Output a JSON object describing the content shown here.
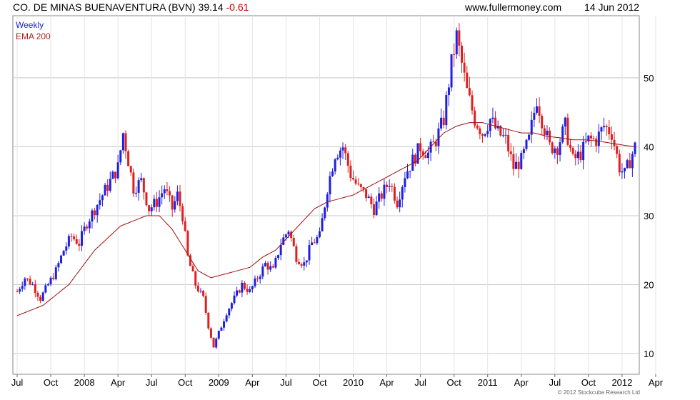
{
  "header": {
    "ticker_title": "CO. DE MINAS BUENAVENTURA (BVN) 39.14",
    "ticker_change": "-0.61",
    "site": "www.fullermoney.com",
    "date": "14 Jun 2012"
  },
  "legend": {
    "weekly": "Weekly",
    "ema": "EMA 200"
  },
  "copyright": "© 2012 Stockcube Research Ltd",
  "colors": {
    "up": "#1f1fe0",
    "down": "#e01f1f",
    "ema": "#a01010",
    "grid": "#d9d9d9"
  },
  "chart_data": {
    "type": "candlestick",
    "series_label": "Weekly",
    "overlay_label": "EMA 200",
    "ylim": [
      7,
      59
    ],
    "y_ticks": [
      10,
      20,
      30,
      40,
      50
    ],
    "x_ticks": [
      "Jul",
      "Oct",
      "2008",
      "Apr",
      "Jul",
      "Oct",
      "2009",
      "Apr",
      "Jul",
      "Oct",
      "2010",
      "Apr",
      "Jul",
      "Oct",
      "2011",
      "Apr",
      "Jul",
      "Oct",
      "2012",
      "Apr"
    ],
    "price_path": [
      [
        0,
        19
      ],
      [
        3,
        21
      ],
      [
        6,
        20
      ],
      [
        9,
        18
      ],
      [
        12,
        20
      ],
      [
        15,
        22
      ],
      [
        18,
        25
      ],
      [
        21,
        27
      ],
      [
        24,
        26
      ],
      [
        27,
        29
      ],
      [
        30,
        31
      ],
      [
        33,
        33
      ],
      [
        36,
        35
      ],
      [
        39,
        37
      ],
      [
        41,
        42
      ],
      [
        43,
        38
      ],
      [
        45,
        34
      ],
      [
        48,
        35
      ],
      [
        51,
        31
      ],
      [
        54,
        32
      ],
      [
        57,
        34
      ],
      [
        60,
        31
      ],
      [
        62,
        33
      ],
      [
        64,
        30
      ],
      [
        66,
        24
      ],
      [
        69,
        20
      ],
      [
        72,
        18
      ],
      [
        74,
        14
      ],
      [
        76,
        11
      ],
      [
        78,
        13
      ],
      [
        81,
        16
      ],
      [
        84,
        18
      ],
      [
        87,
        20
      ],
      [
        90,
        19
      ],
      [
        93,
        21
      ],
      [
        96,
        23
      ],
      [
        99,
        22
      ],
      [
        102,
        26
      ],
      [
        105,
        28
      ],
      [
        108,
        24
      ],
      [
        111,
        23
      ],
      [
        114,
        26
      ],
      [
        117,
        27
      ],
      [
        120,
        34
      ],
      [
        123,
        39
      ],
      [
        126,
        40
      ],
      [
        129,
        36
      ],
      [
        132,
        34
      ],
      [
        135,
        33
      ],
      [
        138,
        31
      ],
      [
        141,
        33
      ],
      [
        144,
        35
      ],
      [
        147,
        32
      ],
      [
        150,
        36
      ],
      [
        153,
        38
      ],
      [
        156,
        40
      ],
      [
        159,
        39
      ],
      [
        162,
        41
      ],
      [
        165,
        44
      ],
      [
        168,
        52
      ],
      [
        170,
        56
      ],
      [
        172,
        52
      ],
      [
        174,
        48
      ],
      [
        177,
        44
      ],
      [
        180,
        42
      ],
      [
        183,
        44
      ],
      [
        186,
        42
      ],
      [
        189,
        41
      ],
      [
        192,
        37
      ],
      [
        195,
        38
      ],
      [
        198,
        41
      ],
      [
        201,
        47
      ],
      [
        203,
        44
      ],
      [
        206,
        40
      ],
      [
        209,
        40
      ],
      [
        212,
        43
      ],
      [
        215,
        38
      ],
      [
        218,
        39
      ],
      [
        221,
        41
      ],
      [
        224,
        41
      ],
      [
        227,
        43
      ],
      [
        230,
        42
      ],
      [
        233,
        37
      ],
      [
        235,
        36
      ],
      [
        237,
        38
      ],
      [
        239,
        40
      ]
    ],
    "ema_path": [
      [
        0,
        15.5
      ],
      [
        10,
        17
      ],
      [
        20,
        20
      ],
      [
        30,
        25
      ],
      [
        40,
        28.5
      ],
      [
        50,
        30
      ],
      [
        55,
        30
      ],
      [
        60,
        28
      ],
      [
        65,
        25
      ],
      [
        70,
        22
      ],
      [
        75,
        21
      ],
      [
        80,
        21.5
      ],
      [
        85,
        22
      ],
      [
        90,
        22.5
      ],
      [
        95,
        24
      ],
      [
        100,
        25
      ],
      [
        105,
        27
      ],
      [
        110,
        29
      ],
      [
        115,
        31
      ],
      [
        120,
        32
      ],
      [
        125,
        32.5
      ],
      [
        130,
        33
      ],
      [
        135,
        34
      ],
      [
        140,
        35
      ],
      [
        145,
        36
      ],
      [
        150,
        37
      ],
      [
        155,
        38
      ],
      [
        160,
        40
      ],
      [
        165,
        42
      ],
      [
        170,
        43
      ],
      [
        175,
        43.5
      ],
      [
        180,
        43.5
      ],
      [
        185,
        43
      ],
      [
        190,
        42.5
      ],
      [
        195,
        42
      ],
      [
        200,
        42
      ],
      [
        205,
        41.5
      ],
      [
        210,
        41.3
      ],
      [
        215,
        41
      ],
      [
        220,
        41
      ],
      [
        225,
        40.8
      ],
      [
        230,
        40.5
      ],
      [
        235,
        40.2
      ],
      [
        239,
        40
      ]
    ]
  }
}
